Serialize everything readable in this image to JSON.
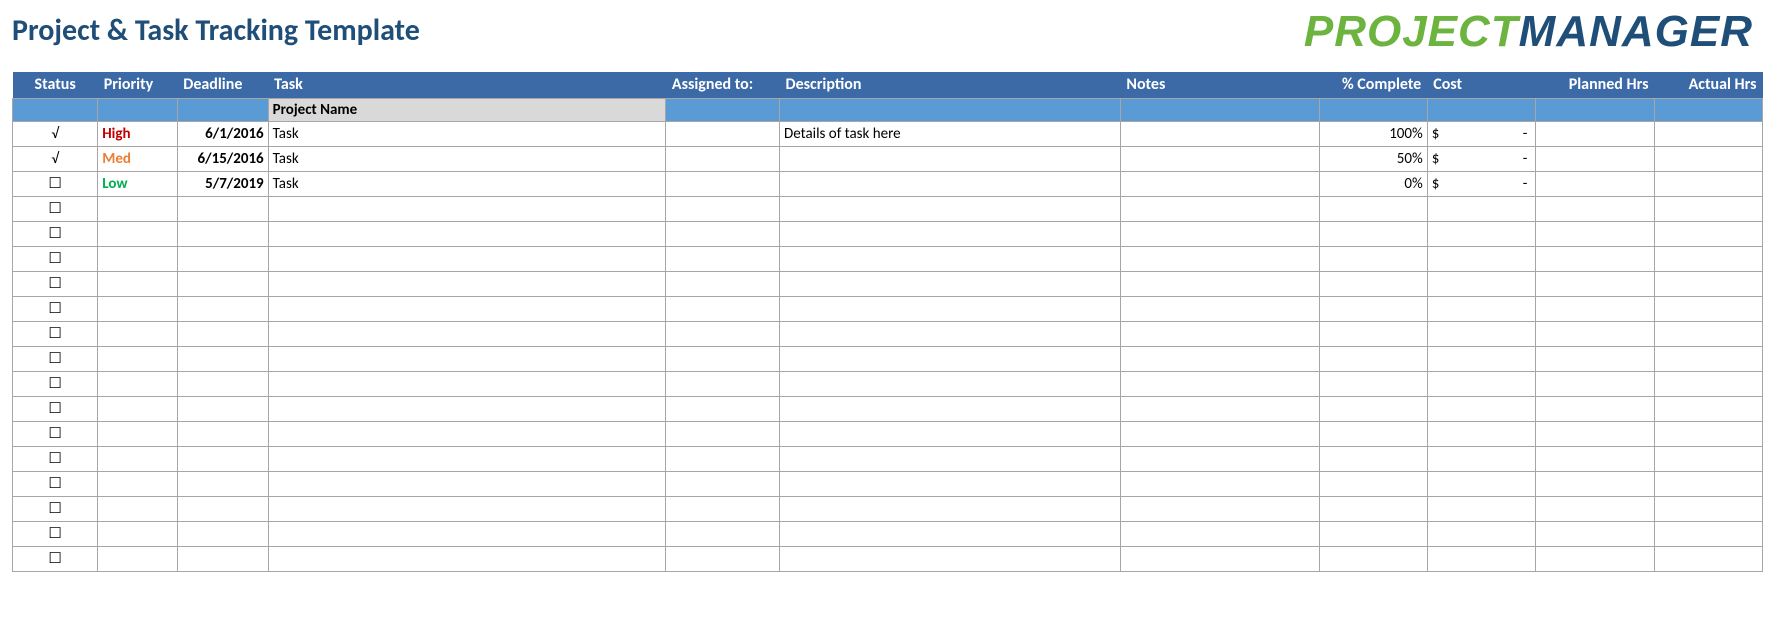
{
  "title": "Project & Task Tracking Template",
  "logo": {
    "part1": "PROJECT",
    "part2": "MANAGER"
  },
  "headers": {
    "status": "Status",
    "priority": "Priority",
    "deadline": "Deadline",
    "task": "Task",
    "assigned": "Assigned to:",
    "description": "Description",
    "notes": "Notes",
    "pct": "% Complete",
    "cost": "Cost",
    "planned": "Planned Hrs",
    "actual": "Actual Hrs"
  },
  "subheader": {
    "task": "Project Name"
  },
  "status_glyph": {
    "done": "√",
    "open": "☐"
  },
  "cost_default": {
    "currency": "$",
    "dash": "-"
  },
  "rows": [
    {
      "status": "done",
      "priority": "High",
      "priority_class": "high",
      "deadline": "6/1/2016",
      "task": "Task",
      "assigned": "",
      "description": "Details of task here",
      "notes": "",
      "pct": "100%",
      "cost": true,
      "planned": "",
      "actual": ""
    },
    {
      "status": "done",
      "priority": "Med",
      "priority_class": "med",
      "deadline": "6/15/2016",
      "task": "Task",
      "assigned": "",
      "description": "",
      "notes": "",
      "pct": "50%",
      "cost": true,
      "planned": "",
      "actual": ""
    },
    {
      "status": "open",
      "priority": "Low",
      "priority_class": "low",
      "deadline": "5/7/2019",
      "task": "Task",
      "assigned": "",
      "description": "",
      "notes": "",
      "pct": "0%",
      "cost": true,
      "planned": "",
      "actual": ""
    },
    {
      "status": "open"
    },
    {
      "status": "open"
    },
    {
      "status": "open"
    },
    {
      "status": "open"
    },
    {
      "status": "open"
    },
    {
      "status": "open"
    },
    {
      "status": "open"
    },
    {
      "status": "open"
    },
    {
      "status": "open"
    },
    {
      "status": "open"
    },
    {
      "status": "open"
    },
    {
      "status": "open"
    },
    {
      "status": "open"
    },
    {
      "status": "open"
    },
    {
      "status": "open"
    }
  ]
}
